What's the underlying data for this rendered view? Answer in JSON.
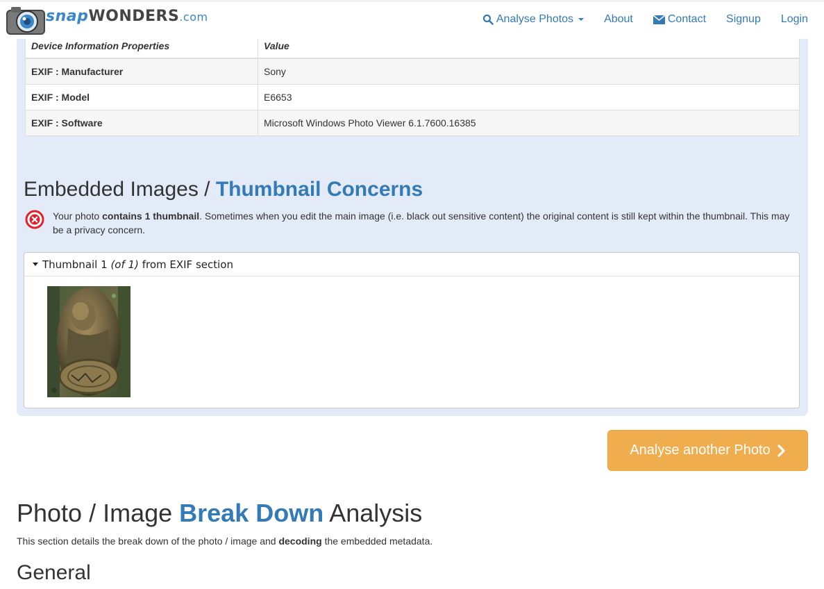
{
  "nav": {
    "logo": {
      "snap": "snap",
      "wonders": "WONDERS",
      "com": ".com"
    },
    "links": [
      {
        "label": "Analyse Photos",
        "icon": "search-icon",
        "dropdown": true
      },
      {
        "label": "About"
      },
      {
        "label": "Contact",
        "icon": "envelope-icon"
      },
      {
        "label": "Signup"
      },
      {
        "label": "Login"
      }
    ]
  },
  "device_table": {
    "headers": [
      "Device Information Properties",
      "Value"
    ],
    "rows": [
      {
        "property": "EXIF : Manufacturer",
        "value": "Sony"
      },
      {
        "property": "EXIF : Model",
        "value": "E6653"
      },
      {
        "property": "EXIF : Software",
        "value": "Microsoft Windows Photo Viewer 6.1.7600.16385"
      }
    ]
  },
  "embedded": {
    "title_plain": "Embedded Images / ",
    "title_highlight": "Thumbnail Concerns",
    "alert_icon": "error-circle-icon",
    "alert_prefix": "Your photo ",
    "alert_bold": "contains 1 thumbnail",
    "alert_rest": ". Sometimes when you edit the main image (i.e. black out sensitive content) the original content is still kept within the thumbnail. This may be a privacy concern.",
    "thumbnail_label": "Thumbnail 1",
    "thumbnail_of": "(of 1)",
    "thumbnail_source": "from EXIF section"
  },
  "cta_label": "Analyse another Photo",
  "breakdown": {
    "title_plain1": "Photo / Image ",
    "title_highlight": "Break Down",
    "title_plain2": " Analysis",
    "lead_prefix": "This section details the break down of the photo / image and ",
    "lead_bold": "decoding",
    "lead_suffix": " the embedded metadata.",
    "general_heading": "General"
  },
  "colors": {
    "brand": "#337ab7",
    "panel": "#e2ebf7",
    "cta": "#f0ad4e",
    "danger": "#e0202a"
  }
}
